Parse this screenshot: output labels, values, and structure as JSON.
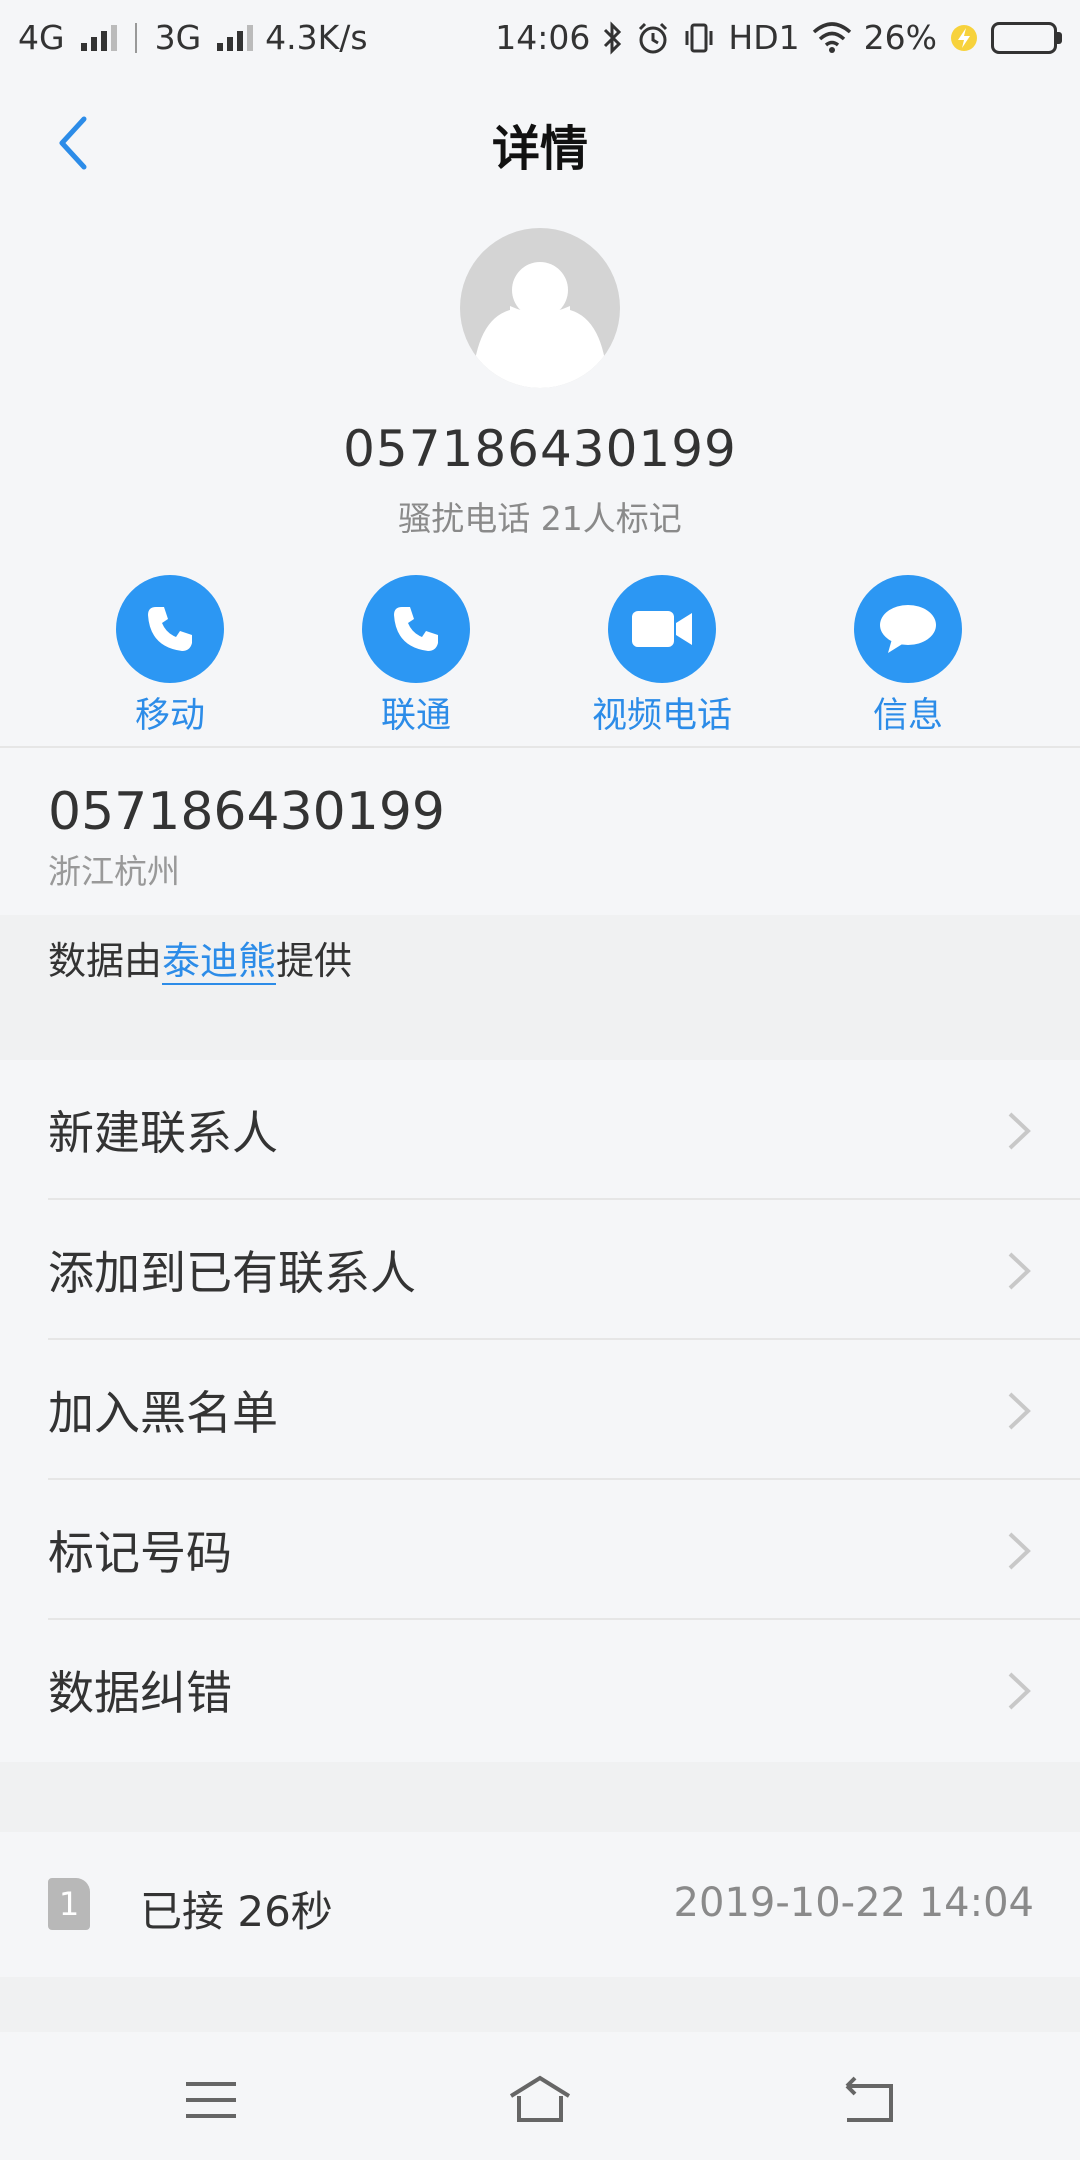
{
  "status_bar": {
    "net1": "4G",
    "net2": "3G",
    "speed": "4.3K/s",
    "time": "14:06",
    "hd": "HD1",
    "battery": "26%",
    "battery_level": 0.26
  },
  "header": {
    "title": "详情"
  },
  "hero": {
    "number": "057186430199",
    "tag": "骚扰电话 21人标记"
  },
  "actions": [
    {
      "label": "移动",
      "icon": "phone-icon"
    },
    {
      "label": "联通",
      "icon": "phone-icon"
    },
    {
      "label": "视频电话",
      "icon": "video-camera-icon"
    },
    {
      "label": "信息",
      "icon": "message-bubble-icon"
    }
  ],
  "info": {
    "number": "057186430199",
    "location": "浙江杭州"
  },
  "provider": {
    "prefix": "数据由",
    "name": "泰迪熊",
    "suffix": "提供"
  },
  "menu": [
    "新建联系人",
    "添加到已有联系人",
    "加入黑名单",
    "标记号码",
    "数据纠错"
  ],
  "call_log": {
    "sim": "1",
    "status": "已接 26秒",
    "time": "2019-10-22 14:04"
  },
  "colors": {
    "accent": "#2c97f3",
    "link": "#2c8ce8",
    "background": "#f5f6f8"
  }
}
